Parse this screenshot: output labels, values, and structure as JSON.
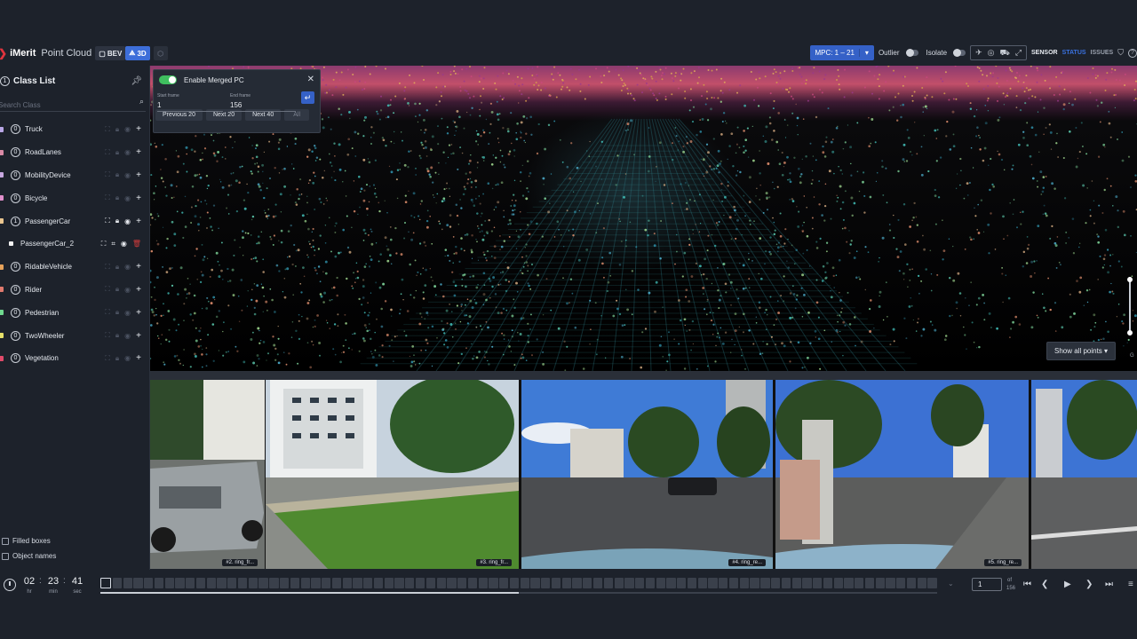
{
  "toolbar": {
    "logo_mark": "❯",
    "logo_text": "iMerit",
    "product": "Point Cloud",
    "bev_label": "BEV",
    "threed_label": "3D",
    "mpc_label": "MPC: 1 – 21",
    "outlier_label": "Outlier",
    "isolate_label": "Isolate",
    "sensor_tab": "SENSOR",
    "status_tab": "STATUS",
    "issues_tab": "ISSUES"
  },
  "sidebar": {
    "title_count": "1",
    "title": "Class List",
    "search_placeholder": "Search Class",
    "classes": [
      {
        "count": "0",
        "name": "Truck",
        "color": "#b9a7e6"
      },
      {
        "count": "0",
        "name": "RoadLanes",
        "color": "#d98aa6"
      },
      {
        "count": "0",
        "name": "MobilityDevice",
        "color": "#c8a8e0"
      },
      {
        "count": "0",
        "name": "Bicycle",
        "color": "#e08fcb"
      },
      {
        "count": "1",
        "name": "PassengerCar",
        "color": "#e9c58f"
      },
      {
        "count": "0",
        "name": "RidableVehicle",
        "color": "#e6a25a"
      },
      {
        "count": "0",
        "name": "Rider",
        "color": "#e07a6e"
      },
      {
        "count": "0",
        "name": "Pedestrian",
        "color": "#6fd98f"
      },
      {
        "count": "0",
        "name": "TwoWheeler",
        "color": "#e6e06a"
      },
      {
        "count": "0",
        "name": "Vegetation",
        "color": "#e04a6a"
      }
    ],
    "sub_item": {
      "name": "PassengerCar_2",
      "color": "#f2f2f2"
    },
    "filled_boxes": "Filled boxes",
    "object_names": "Object names"
  },
  "merge_panel": {
    "title": "Enable Merged PC",
    "start_label": "Start frame",
    "start_value": "1",
    "end_label": "End frame",
    "end_value": "156",
    "btn_prev20": "Previous 20",
    "btn_next20": "Next 20",
    "btn_next40": "Next 40",
    "btn_all": "All"
  },
  "viewport": {
    "show_points": "Show all points",
    "slider_label": "G"
  },
  "cameras": [
    {
      "label": "#2. ring_fr..."
    },
    {
      "label": "#3. ring_fr..."
    },
    {
      "label": "#4. ring_re..."
    },
    {
      "label": "#5. ring_re..."
    }
  ],
  "timeline": {
    "hours": "02",
    "minutes": "23",
    "seconds": "41",
    "hr_label": "hr",
    "min_label": "min",
    "sec_label": "sec",
    "current_frame": "1",
    "of_label": "of",
    "total_frames": "156",
    "progress": 0.5
  }
}
